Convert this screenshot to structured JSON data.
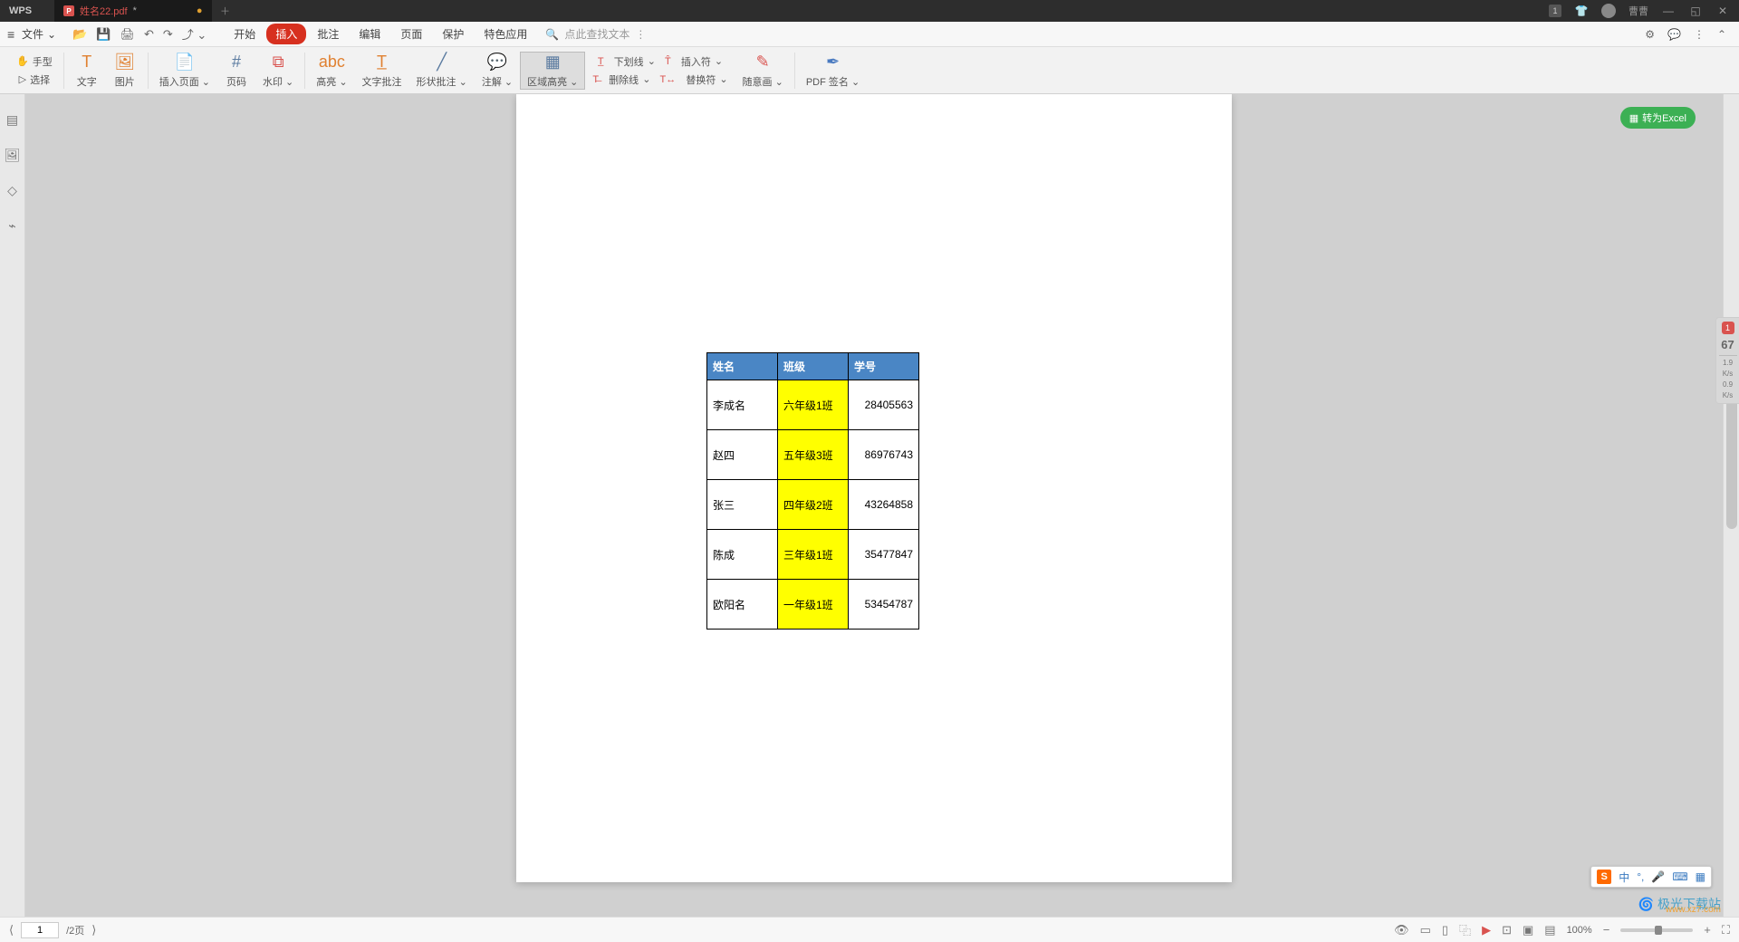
{
  "title_bar": {
    "app_name": "WPS",
    "tab_file": "姓名22.pdf",
    "modified_mark": "*",
    "user_name": "曹曹",
    "notif_count": "1"
  },
  "menu_bar": {
    "file_label": "文件",
    "tabs": [
      "开始",
      "插入",
      "批注",
      "编辑",
      "页面",
      "保护",
      "特色应用"
    ],
    "active_tab": "插入",
    "search_placeholder": "点此查找文本"
  },
  "ribbon": {
    "hand": "手型",
    "select": "选择",
    "text": "文字",
    "image": "图片",
    "insert_page": "插入页面",
    "page_number": "页码",
    "watermark": "水印",
    "highlight": "高亮",
    "text_annot": "文字批注",
    "shape_annot": "形状批注",
    "annotate": "注解",
    "area_highlight": "区域高亮",
    "underline": "下划线",
    "insert_char": "插入符",
    "strikethrough": "删除线",
    "replace_char": "替换符",
    "freehand": "随意画",
    "pdf_sign": "PDF 签名"
  },
  "excel_button": "转为Excel",
  "table": {
    "headers": [
      "姓名",
      "班级",
      "学号"
    ],
    "rows": [
      {
        "name": "李成名",
        "class": "六年级1班",
        "id": "28405563"
      },
      {
        "name": "赵四",
        "class": "五年级3班",
        "id": "86976743"
      },
      {
        "name": "张三",
        "class": "四年级2班",
        "id": "43264858"
      },
      {
        "name": "陈成",
        "class": "三年级1班",
        "id": "35477847"
      },
      {
        "name": "欧阳名",
        "class": "一年级1班",
        "id": "53454787"
      }
    ]
  },
  "gauge": {
    "badge": "1",
    "pct": "67",
    "up": "1.9",
    "up_u": "K/s",
    "dn": "0.9",
    "dn_u": "K/s"
  },
  "ime": {
    "lang": "中",
    "punct": "°,",
    "mic": "🎤",
    "kb": "⌨",
    "grid": "⊞"
  },
  "watermark": {
    "brand": "极光下载站",
    "url": "www.xz7.com"
  },
  "status": {
    "page_current": "1",
    "page_total": "/2页",
    "zoom": "100%"
  }
}
